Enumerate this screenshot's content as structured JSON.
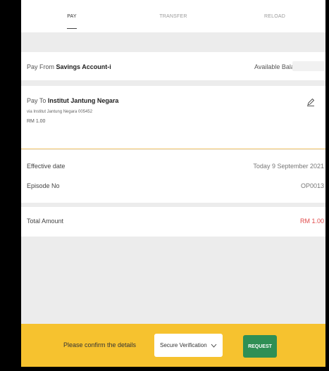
{
  "tabs": [
    {
      "label": "PAY",
      "active": true
    },
    {
      "label": "TRANSFER",
      "active": false
    },
    {
      "label": "RELOAD",
      "active": false
    }
  ],
  "pay_from": {
    "prefix": "Pay From ",
    "account": "Savings Account-i",
    "available_balance_label": "Available Balance"
  },
  "pay_to": {
    "prefix": "Pay To ",
    "payee": "Institut Jantung Negara",
    "via": "via Institut Jantung Negara 005452",
    "amount": "RM 1.00"
  },
  "details": {
    "effective_date_label": "Effective date",
    "effective_date_value": "Today 9 September 2021",
    "episode_label": "Episode No",
    "episode_value": "OP0013"
  },
  "total": {
    "label": "Total Amount",
    "value": "RM 1.00"
  },
  "footer": {
    "message": "Please confirm the details",
    "verification_selected": "Secure Verification",
    "request_label": "REQUEST"
  },
  "colors": {
    "footer_bg": "#f6c22f",
    "request_bg": "#2f8f55",
    "total_value": "#e04a4a",
    "divider_accent": "#f0c36a"
  },
  "icons": {
    "edit": "pencil-icon",
    "dropdown": "chevron-down-icon"
  }
}
